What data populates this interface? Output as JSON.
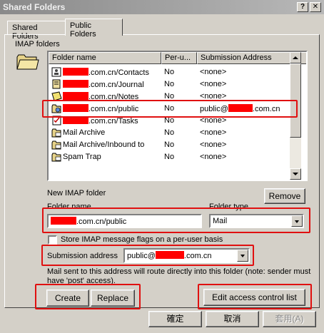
{
  "window": {
    "title": "Shared Folders",
    "help_label": "?",
    "close_label": "✕"
  },
  "tabs": [
    {
      "label": "Shared Folders"
    },
    {
      "label": "Public Folders"
    }
  ],
  "imap_group_label": "IMAP folders",
  "list": {
    "headers": [
      "Folder name",
      "Per-u...",
      "Submission Address"
    ],
    "rows": [
      {
        "name": ".com.cn/Contacts",
        "per_user": "No",
        "address": "<none>",
        "icon": "contacts-icon"
      },
      {
        "name": ".com.cn/Journal",
        "per_user": "No",
        "address": "<none>",
        "icon": "journal-icon"
      },
      {
        "name": ".com.cn/Notes",
        "per_user": "No",
        "address": "<none>",
        "icon": "notes-icon"
      },
      {
        "name": ".com.cn/public",
        "per_user": "No",
        "address_prefix": "public@",
        "address_suffix": ".com.cn",
        "icon": "public-folder-icon"
      },
      {
        "name": ".com.cn/Tasks",
        "per_user": "No",
        "address": "<none>",
        "icon": "tasks-icon"
      },
      {
        "name": "Mail Archive",
        "per_user": "No",
        "address": "<none>",
        "icon": "mail-folder-icon"
      },
      {
        "name": "Mail Archive/Inbound to",
        "per_user": "No",
        "address": "<none>",
        "icon": "mail-folder-icon"
      },
      {
        "name": "Spam Trap",
        "per_user": "No",
        "address": "<none>",
        "icon": "mail-folder-icon"
      }
    ]
  },
  "new_folder_label": "New IMAP folder",
  "remove_label": "Remove",
  "folder_name_label": "Folder name",
  "folder_name_value": ".com.cn/public",
  "folder_type_label": "Folder type",
  "folder_type_value": "Mail",
  "store_flags_label": "Store IMAP message flags on a per-user basis",
  "submission_label": "Submission address",
  "submission_prefix": "public@",
  "submission_suffix": ".com.cn",
  "note_text_line1": "Mail sent to this address will route directly into this folder (note: sender must",
  "note_text_line2": "have 'post' access).",
  "create_label": "Create",
  "replace_label": "Replace",
  "edit_acl_label": "Edit access control list",
  "ok_label": "確定",
  "cancel_label": "取消",
  "apply_label": "套用(A)",
  "colors": {
    "annotation": "#e01010",
    "redaction": "#ff0000",
    "dialog": "#d4d0c8"
  }
}
